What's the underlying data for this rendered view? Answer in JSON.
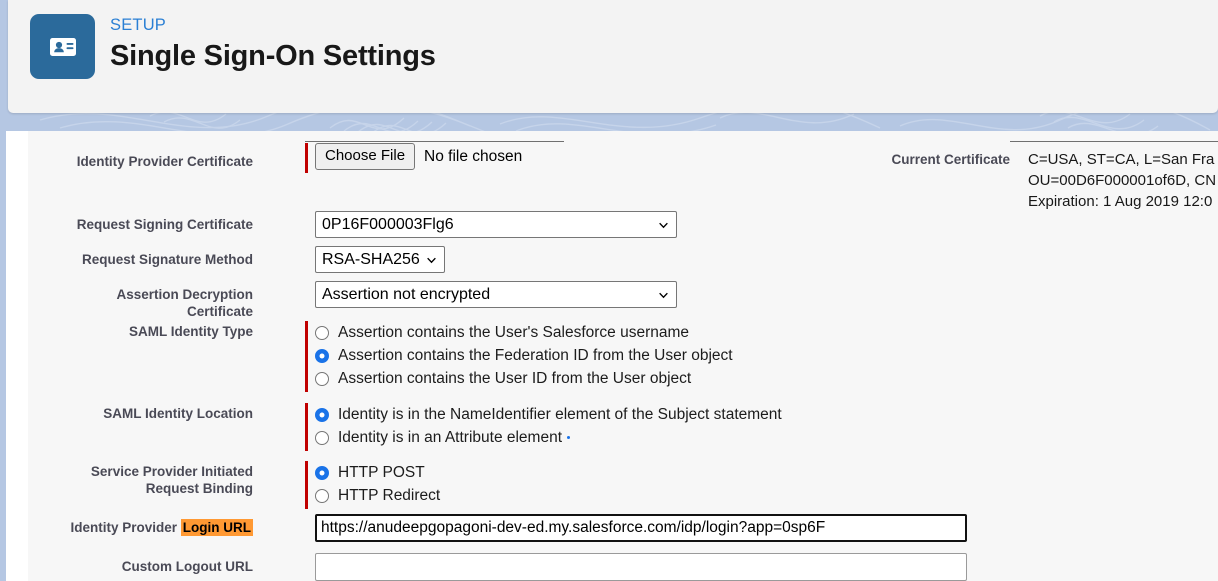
{
  "header": {
    "icon": "id-card-icon",
    "eyebrow": "SETUP",
    "title": "Single Sign-On Settings",
    "icon_bg": "#2b6a9b",
    "eyebrow_color": "#2a7fd4"
  },
  "form": {
    "identity_provider_certificate": {
      "label": "Identity Provider Certificate",
      "required": true,
      "choose_file_label": "Choose File",
      "file_status": "No file chosen"
    },
    "request_signing_certificate": {
      "label": "Request Signing Certificate",
      "value": "0P16F000003Flg6"
    },
    "request_signature_method": {
      "label": "Request Signature Method",
      "value": "RSA-SHA256"
    },
    "assertion_decryption_certificate": {
      "label": "Assertion Decryption Certificate",
      "label_line1": "Assertion Decryption",
      "label_line2": "Certificate",
      "value": "Assertion not encrypted"
    },
    "saml_identity_type": {
      "label": "SAML Identity Type",
      "required": true,
      "selected_index": 1,
      "options": [
        "Assertion contains the User's Salesforce username",
        "Assertion contains the Federation ID from the User object",
        "Assertion contains the User ID from the User object"
      ]
    },
    "saml_identity_location": {
      "label": "SAML Identity Location",
      "required": true,
      "selected_index": 0,
      "options": [
        "Identity is in the NameIdentifier element of the Subject statement",
        "Identity is in an Attribute element"
      ]
    },
    "service_provider_initiated_request_binding": {
      "label": "Service Provider Initiated Request Binding",
      "label_line1": "Service Provider Initiated",
      "label_line2": "Request Binding",
      "required": true,
      "selected_index": 0,
      "options": [
        "HTTP POST",
        "HTTP Redirect"
      ]
    },
    "identity_provider_login_url": {
      "label_prefix": "Identity Provider ",
      "label_highlight": "Login URL",
      "highlight_color": "#ff9933",
      "value": "https://anudeepgopagoni-dev-ed.my.salesforce.com/idp/login?app=0sp6F"
    },
    "custom_logout_url": {
      "label": "Custom Logout URL",
      "value": "",
      "placeholder": ""
    }
  },
  "current_certificate": {
    "label": "Current Certificate",
    "line1": "C=USA, ST=CA, L=San Fra",
    "line2": "OU=00D6F000001of6D, CN",
    "line3": "Expiration: 1 Aug 2019 12:0"
  }
}
